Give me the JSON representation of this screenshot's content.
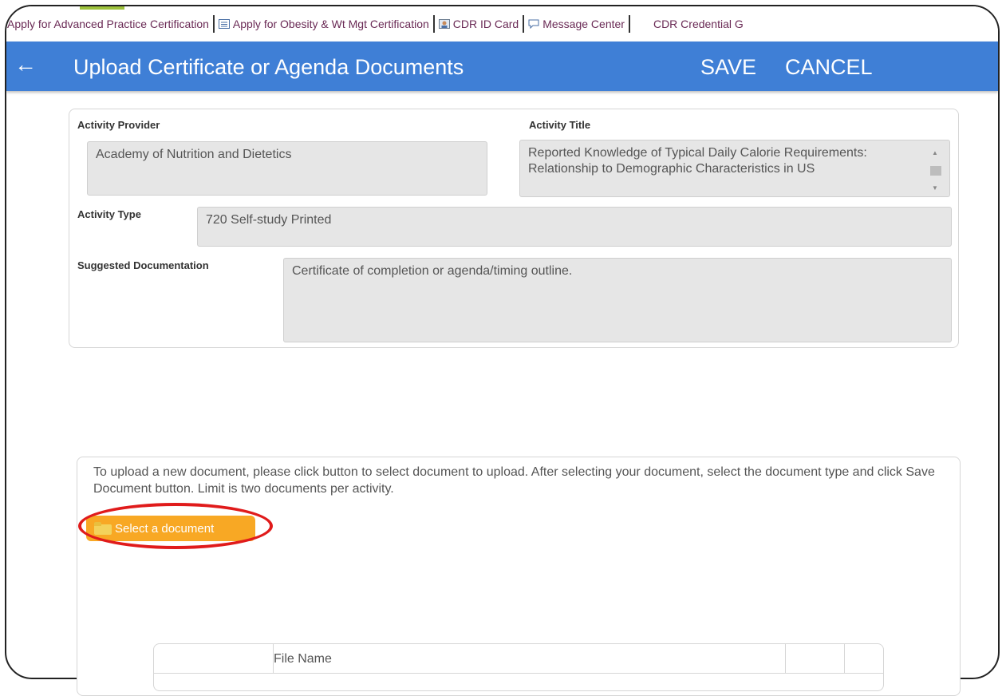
{
  "linkbar": {
    "items": [
      {
        "label": "Apply for Advanced Practice Certification",
        "icon": ""
      },
      {
        "label": "Apply for Obesity & Wt Mgt Certification",
        "icon": "form-icon"
      },
      {
        "label": "CDR ID Card",
        "icon": "id-card-icon"
      },
      {
        "label": "Message Center",
        "icon": "speech-bubble-icon"
      },
      {
        "label": "CDR Credential G",
        "icon": ""
      }
    ]
  },
  "header": {
    "back_icon": "←",
    "title": "Upload Certificate or Agenda Documents",
    "save_label": "SAVE",
    "cancel_label": "CANCEL",
    "color": "#3f7fd6"
  },
  "details": {
    "provider_label": "Activity Provider",
    "provider_value": "Academy of Nutrition and Dietetics",
    "title_label": "Activity Title",
    "title_value": "Reported Knowledge of Typical Daily Calorie Requirements: Relationship to Demographic Characteristics in US",
    "type_label": "Activity Type",
    "type_value": "720 Self-study Printed",
    "doc_label": "Suggested Documentation",
    "doc_value": "Certificate of completion or agenda/timing outline."
  },
  "upload": {
    "instructions": "To upload a new document, please click button to select document to upload. After selecting your document, select the document type and click Save Document button.  Limit is two documents per activity.",
    "select_label": "Select a document",
    "select_color": "#f8a824",
    "highlight_color": "#e01b1b",
    "table_header": "File Name"
  }
}
